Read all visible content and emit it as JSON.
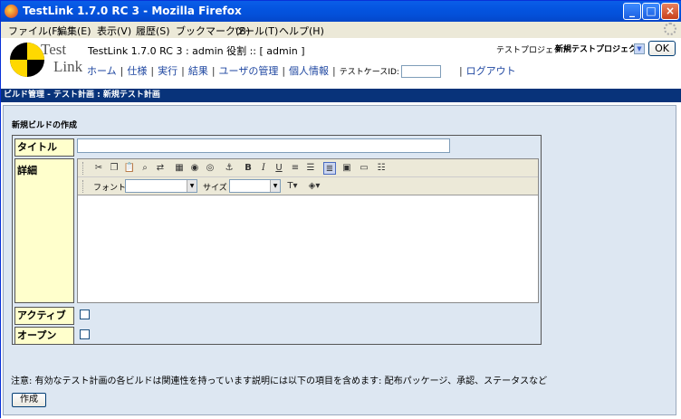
{
  "window": {
    "title": "TestLink 1.7.0 RC 3 - Mozilla Firefox"
  },
  "menubar": [
    "ファイル(F)",
    "編集(E)",
    "表示(V)",
    "履歴(S)",
    "ブックマーク(B)",
    "ツール(T)",
    "ヘルプ(H)"
  ],
  "header": {
    "logo_test": "Test",
    "logo_link": "Link",
    "title": "TestLink 1.7.0 RC 3 : admin 役割 :: [ admin ]",
    "project_label": "テストプロジェクト",
    "project_selected": "新規テストプロジェクト",
    "ok_label": "OK",
    "nav": [
      "ホーム",
      "仕様",
      "実行",
      "結果",
      "ユーザの管理",
      "個人情報"
    ],
    "testcase_label": "テストケースID:",
    "logout": "ログアウト"
  },
  "breadcrumb": "ビルド管理 - テスト計画 : 新規テスト計画",
  "form": {
    "section_title": "新規ビルドの作成",
    "title_label": "タイトル",
    "title_value": "",
    "detail_label": "詳細",
    "active_label": "アクティブ",
    "open_label": "オープン",
    "font_label": "フォント",
    "size_label": "サイズ"
  },
  "note": "注意: 有効なテスト計画の各ビルドは関連性を持っています説明には以下の項目を含めます: 配布パッケージ、承認、ステータスなど",
  "create_button": "作成"
}
